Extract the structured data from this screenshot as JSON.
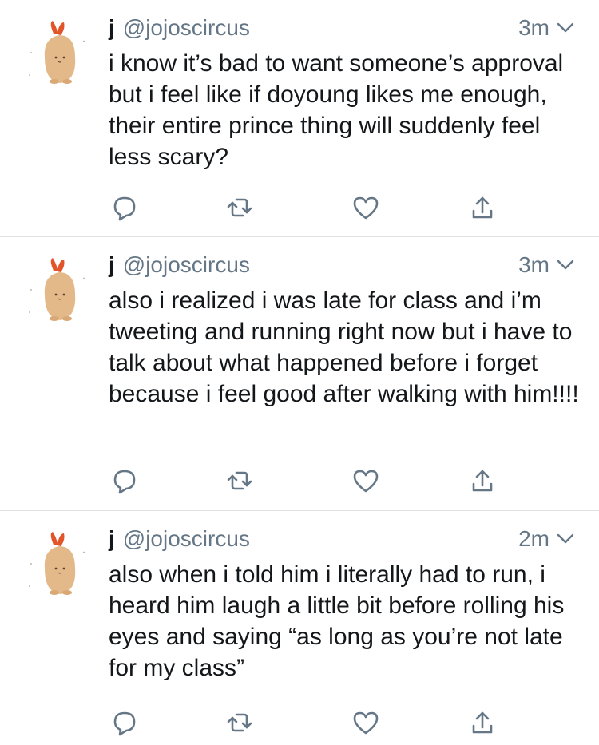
{
  "colors": {
    "text_primary": "#14171a",
    "text_secondary": "#657786",
    "icon": "#657786",
    "divider": "#dfe3e6",
    "avatar_body": "#e3b98a",
    "avatar_tail": "#e2542a"
  },
  "tweets": [
    {
      "avatar_icon": "fried-shrimp-plush-avatar",
      "display_name": "j",
      "handle": "@jojoscircus",
      "timestamp": "3m",
      "text": "i know it’s bad to want someone’s approval but i feel like if doyoung likes me enough, their entire prince thing will suddenly feel less scary?"
    },
    {
      "avatar_icon": "fried-shrimp-plush-avatar",
      "display_name": "j",
      "handle": "@jojoscircus",
      "timestamp": "3m",
      "text": "also i realized i was late for class and i’m tweeting and running right now but i have to talk about what happened before i forget because i feel good after walking with him!!!!"
    },
    {
      "avatar_icon": "fried-shrimp-plush-avatar",
      "display_name": "j",
      "handle": "@jojoscircus",
      "timestamp": "2m",
      "text": "also when i told him i literally had to run, i heard him laugh a little bit before rolling his eyes and saying “as long as you’re not late for my class”"
    }
  ],
  "action_icons": [
    "reply-icon",
    "retweet-icon",
    "like-icon",
    "share-icon"
  ]
}
